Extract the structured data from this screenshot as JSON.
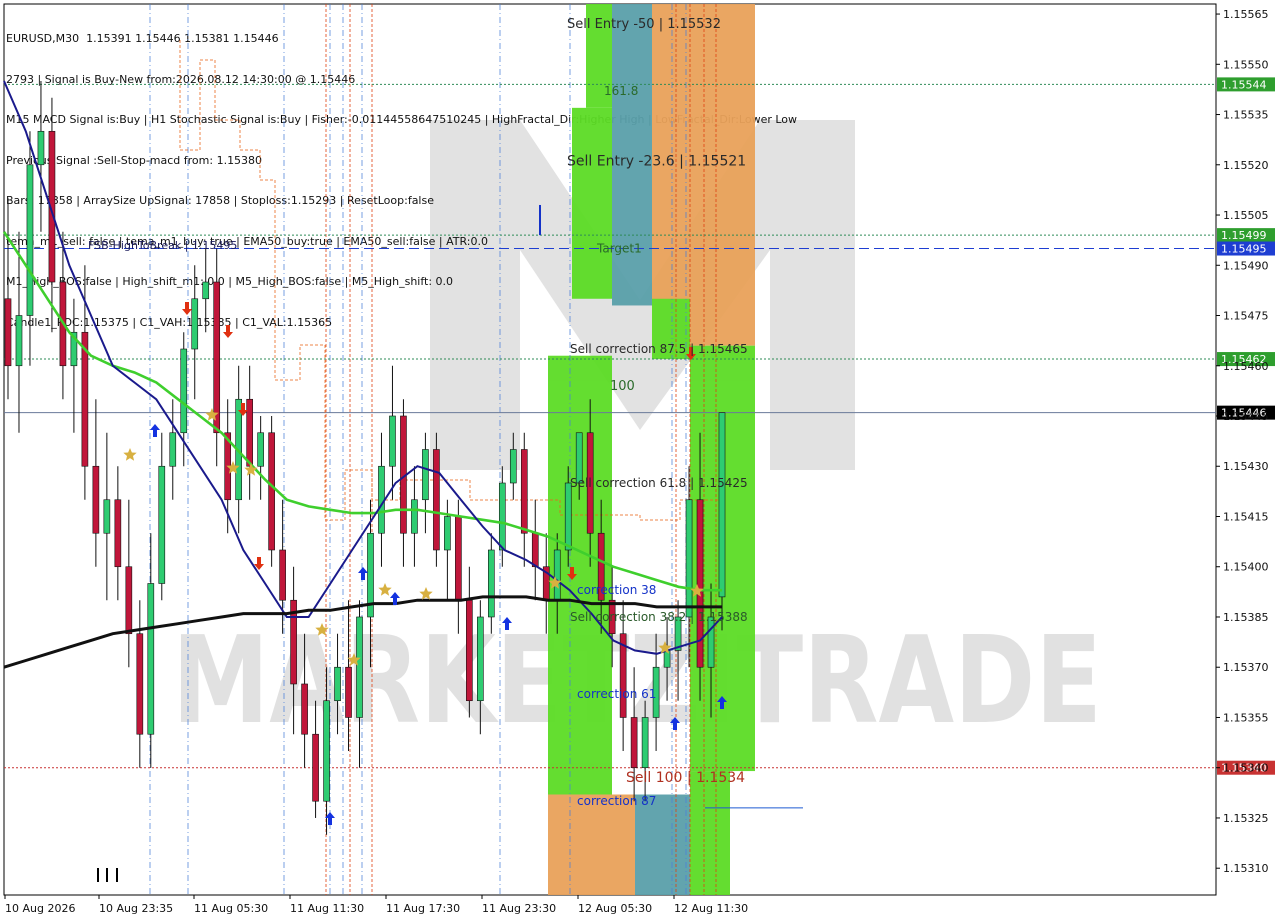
{
  "header": {
    "symbol": "EURUSD,M30",
    "ohlc": "1.15391 1.15446 1.15381 1.15446",
    "lines": [
      "2793 | Signal is Buy-New from:2026.08.12 14:30:00 @ 1.15446",
      "M15 MACD Signal is:Buy | H1 Stochastic Signal is:Buy | Fisher:-0.01144558647510245 | HighFractal_Dir:Higher High | LowFractal_Dir:Lower Low",
      "Previous Signal :Sell-Stop-macd from: 1.15380",
      "Bars: 17858 | ArraySize UpSignal: 17858 | Stoploss:1.15293 | ResetLoop:false",
      "tema_m1_sell: false | tema_m1_buy: true | EMA50_buy:true | EMA50_sell:false | ATR:0.0",
      "M1_High_BOS:false | High_shift_m1: 0.0 | M5_High_BOS:false | M5_High_shift: 0.0",
      "Candle1_POC:1.15375 | C1_VAH:1.15385 | C1_VAL:1.15365"
    ]
  },
  "watermark": "MARKETZITRADE",
  "colors": {
    "bull": "#2ecc71",
    "bear": "#c0163a",
    "ema_green": "#3fcf2d",
    "ma_navy": "#1a1a8c",
    "ma_black": "#111111",
    "zone_green": "#5cdc25",
    "zone_orange": "#e9a25a",
    "zone_teal": "#5aa0aa",
    "price_box": "#000000",
    "green_box": "#2e9e2e",
    "red_box": "#c83232",
    "blue_box": "#1e3ed2"
  },
  "chart_data": {
    "type": "candlestick",
    "symbol": "EURUSD",
    "timeframe": "M30",
    "ylim": [
      1.15302,
      1.15568
    ],
    "y_ticks": [
      "1.15565",
      "1.15550",
      "1.15535",
      "1.15520",
      "1.15505",
      "1.15490",
      "1.15475",
      "1.15460",
      "1.15445",
      "1.15430",
      "1.15415",
      "1.15400",
      "1.15385",
      "1.15370",
      "1.15355",
      "1.15340",
      "1.15325",
      "1.15310"
    ],
    "x_labels": [
      "10 Aug 2026",
      "10 Aug 23:35",
      "11 Aug 05:30",
      "11 Aug 11:30",
      "11 Aug 17:30",
      "11 Aug 23:30",
      "12 Aug 05:30",
      "12 Aug 11:30"
    ],
    "candles": [
      [
        1.1548,
        1.1551,
        1.1545,
        1.1546
      ],
      [
        1.1546,
        1.155,
        1.1544,
        1.15475
      ],
      [
        1.15475,
        1.1553,
        1.1546,
        1.1552
      ],
      [
        1.1552,
        1.15545,
        1.155,
        1.1553
      ],
      [
        1.1553,
        1.1554,
        1.1547,
        1.15485
      ],
      [
        1.15485,
        1.155,
        1.1545,
        1.1546
      ],
      [
        1.1546,
        1.1548,
        1.1544,
        1.1547
      ],
      [
        1.1547,
        1.1549,
        1.1542,
        1.1543
      ],
      [
        1.1543,
        1.1545,
        1.154,
        1.1541
      ],
      [
        1.1541,
        1.1544,
        1.1539,
        1.1542
      ],
      [
        1.1542,
        1.1543,
        1.1539,
        1.154
      ],
      [
        1.154,
        1.1542,
        1.1537,
        1.1538
      ],
      [
        1.1538,
        1.1539,
        1.1534,
        1.1535
      ],
      [
        1.1535,
        1.1541,
        1.1534,
        1.15395
      ],
      [
        1.15395,
        1.1544,
        1.1539,
        1.1543
      ],
      [
        1.1543,
        1.1545,
        1.1542,
        1.1544
      ],
      [
        1.1544,
        1.1547,
        1.1543,
        1.15465
      ],
      [
        1.15465,
        1.1549,
        1.1545,
        1.1548
      ],
      [
        1.1548,
        1.15495,
        1.1547,
        1.15485
      ],
      [
        1.15485,
        1.15495,
        1.1543,
        1.1544
      ],
      [
        1.1544,
        1.1545,
        1.1541,
        1.1542
      ],
      [
        1.1542,
        1.1546,
        1.1541,
        1.1545
      ],
      [
        1.1545,
        1.1546,
        1.1542,
        1.1543
      ],
      [
        1.1543,
        1.15445,
        1.1542,
        1.1544
      ],
      [
        1.1544,
        1.15445,
        1.154,
        1.15405
      ],
      [
        1.15405,
        1.1542,
        1.1538,
        1.1539
      ],
      [
        1.1539,
        1.154,
        1.1535,
        1.15365
      ],
      [
        1.15365,
        1.1538,
        1.1534,
        1.1535
      ],
      [
        1.1535,
        1.1536,
        1.15325,
        1.1533
      ],
      [
        1.1533,
        1.1537,
        1.1532,
        1.1536
      ],
      [
        1.1536,
        1.1538,
        1.1535,
        1.1537
      ],
      [
        1.1537,
        1.1539,
        1.15345,
        1.15355
      ],
      [
        1.15355,
        1.1539,
        1.1534,
        1.15385
      ],
      [
        1.15385,
        1.1542,
        1.1537,
        1.1541
      ],
      [
        1.1541,
        1.1544,
        1.154,
        1.1543
      ],
      [
        1.1543,
        1.1546,
        1.1542,
        1.15445
      ],
      [
        1.15445,
        1.1545,
        1.154,
        1.1541
      ],
      [
        1.1541,
        1.1543,
        1.154,
        1.1542
      ],
      [
        1.1542,
        1.1544,
        1.1541,
        1.15435
      ],
      [
        1.15435,
        1.1544,
        1.154,
        1.15405
      ],
      [
        1.15405,
        1.1542,
        1.1539,
        1.15415
      ],
      [
        1.15415,
        1.1542,
        1.1538,
        1.1539
      ],
      [
        1.1539,
        1.154,
        1.15355,
        1.1536
      ],
      [
        1.1536,
        1.1539,
        1.1535,
        1.15385
      ],
      [
        1.15385,
        1.1541,
        1.1538,
        1.15405
      ],
      [
        1.15405,
        1.1543,
        1.154,
        1.15425
      ],
      [
        1.15425,
        1.1544,
        1.1542,
        1.15435
      ],
      [
        1.15435,
        1.1544,
        1.154,
        1.1541
      ],
      [
        1.1541,
        1.1542,
        1.1539,
        1.154
      ],
      [
        1.154,
        1.1541,
        1.1538,
        1.1539
      ],
      [
        1.1539,
        1.1541,
        1.1538,
        1.15405
      ],
      [
        1.15405,
        1.1543,
        1.154,
        1.15425
      ],
      [
        1.15425,
        1.1544,
        1.1542,
        1.1544
      ],
      [
        1.1544,
        1.1545,
        1.154,
        1.1541
      ],
      [
        1.1541,
        1.1542,
        1.1538,
        1.1539
      ],
      [
        1.1539,
        1.154,
        1.1537,
        1.1538
      ],
      [
        1.1538,
        1.1539,
        1.15345,
        1.15355
      ],
      [
        1.15355,
        1.1537,
        1.1533,
        1.1534
      ],
      [
        1.1534,
        1.1536,
        1.1533,
        1.15355
      ],
      [
        1.15355,
        1.1538,
        1.15345,
        1.1537
      ],
      [
        1.1537,
        1.15385,
        1.1536,
        1.15375
      ],
      [
        1.15375,
        1.1539,
        1.1536,
        1.15385
      ],
      [
        1.15385,
        1.1543,
        1.1537,
        1.1542
      ],
      [
        1.1542,
        1.1544,
        1.1536,
        1.1537
      ],
      [
        1.1537,
        1.15395,
        1.15355,
        1.15385
      ],
      [
        1.15391,
        1.15446,
        1.15381,
        1.15446
      ]
    ],
    "series": [
      {
        "name": "EMA50",
        "values": [
          1.155,
          1.1549,
          1.1548,
          1.1547,
          1.15463,
          1.1546,
          1.15458,
          1.15455,
          1.1545,
          1.15445,
          1.1544,
          1.15433,
          1.15426,
          1.1542,
          1.15418,
          1.15417,
          1.15416,
          1.15416,
          1.15417,
          1.15417,
          1.15416,
          1.15415,
          1.15414,
          1.15413,
          1.15411,
          1.15409,
          1.15406,
          1.15403,
          1.154,
          1.15398,
          1.15396,
          1.15394,
          1.15393,
          1.15393
        ]
      },
      {
        "name": "",
        "values": [
          1.15545,
          1.1553,
          1.1551,
          1.1549,
          1.15475,
          1.1546,
          1.15455,
          1.1545,
          1.1544,
          1.1543,
          1.1542,
          1.15405,
          1.15395,
          1.15385,
          1.15385,
          1.15395,
          1.15405,
          1.15415,
          1.15425,
          1.1543,
          1.15428,
          1.1542,
          1.15412,
          1.15405,
          1.15402,
          1.15398,
          1.15393,
          1.15386,
          1.15378,
          1.15375,
          1.15374,
          1.15376,
          1.15378,
          1.15385
        ]
      },
      {
        "name": "",
        "values": [
          1.1537,
          1.15372,
          1.15374,
          1.15376,
          1.15378,
          1.1538,
          1.15381,
          1.15382,
          1.15383,
          1.15384,
          1.15385,
          1.15386,
          1.15386,
          1.15386,
          1.15387,
          1.15387,
          1.15388,
          1.15389,
          1.15389,
          1.1539,
          1.1539,
          1.1539,
          1.15391,
          1.15391,
          1.15391,
          1.1539,
          1.1539,
          1.15389,
          1.15389,
          1.15389,
          1.15388,
          1.15388,
          1.15388,
          1.15388
        ]
      }
    ],
    "levels": [
      {
        "price": 1.15544,
        "label": "1.15544",
        "style": "dotted",
        "color": "#2e8b57"
      },
      {
        "price": 1.15499,
        "label": "1.15499",
        "style": "dotted",
        "color": "#2e8b57"
      },
      {
        "price": 1.15495,
        "label": "1.15495",
        "style": "dashed",
        "color": "#1e3ed2"
      },
      {
        "price": 1.15462,
        "label": "1.15462",
        "style": "dotted",
        "color": "#2e8b57"
      },
      {
        "price": 1.15446,
        "label": "1.15446",
        "style": "solid",
        "color": "#6a7a99"
      },
      {
        "price": 1.1534,
        "label": "1.15340",
        "style": "dotted",
        "color": "#c83232"
      }
    ],
    "annotations": [
      {
        "text": "Sell Entry -23.6 | 1.15521",
        "price": 1.15521
      },
      {
        "text": "Sell Entry -50 | 1.15532",
        "price": 1.15562
      },
      {
        "text": "161.8",
        "price": 1.15542
      },
      {
        "text": "Target1",
        "price": 1.15495
      },
      {
        "text": "FSB-HighToBreak | 1.15495",
        "price": 1.15496
      },
      {
        "text": "Sell correction 87.5 | 1.15465",
        "price": 1.15465
      },
      {
        "text": "100",
        "price": 1.15454
      },
      {
        "text": "Sell correction 61.8 | 1.15425",
        "price": 1.15425
      },
      {
        "text": "correction 38",
        "price": 1.15393
      },
      {
        "text": "Sell correction 38.2 | 1.15388",
        "price": 1.15385
      },
      {
        "text": "correction 61",
        "price": 1.15362
      },
      {
        "text": "Sell 100 | 1.1534",
        "price": 1.15337
      },
      {
        "text": "correction 87",
        "price": 1.1533
      }
    ]
  }
}
